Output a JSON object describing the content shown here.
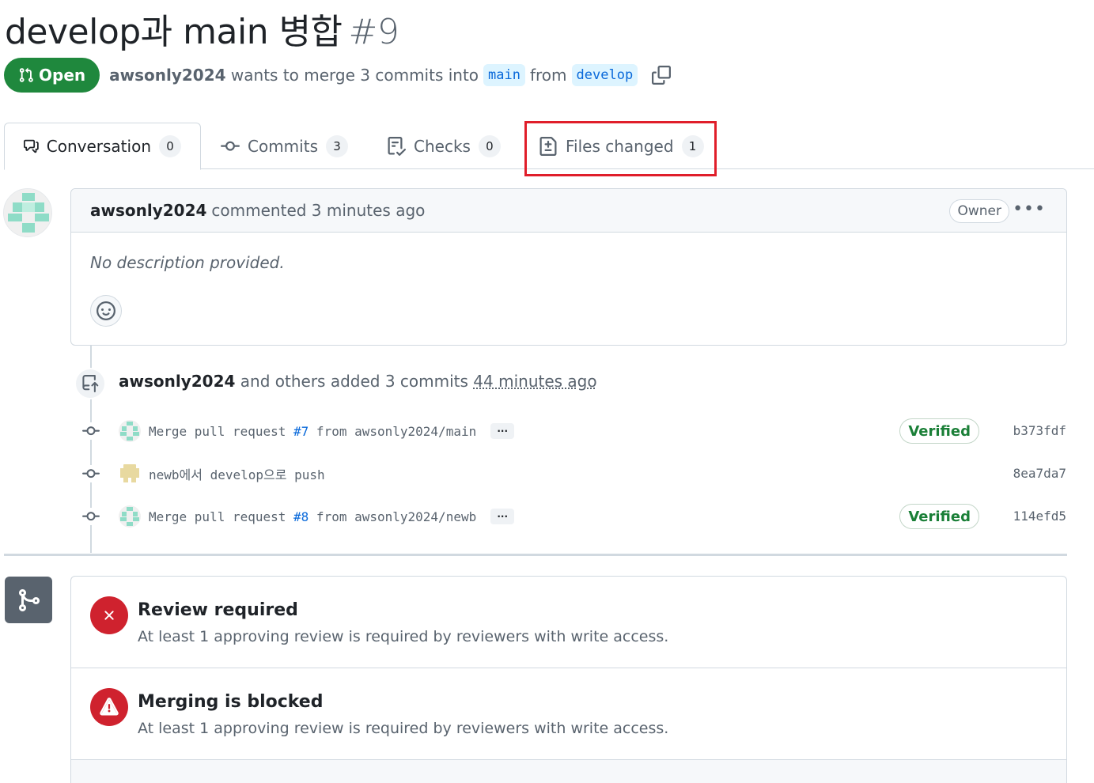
{
  "pr": {
    "title": "develop과 main 병합",
    "number": "#9",
    "state": "Open",
    "author": "awsonly2024",
    "action_text": "wants to merge 3 commits into",
    "base_branch": "main",
    "from_text": "from",
    "head_branch": "develop"
  },
  "tabs": [
    {
      "label": "Conversation",
      "count": "0",
      "icon": "comment-discussion-icon"
    },
    {
      "label": "Commits",
      "count": "3",
      "icon": "git-commit-icon"
    },
    {
      "label": "Checks",
      "count": "0",
      "icon": "checklist-icon"
    },
    {
      "label": "Files changed",
      "count": "1",
      "icon": "file-diff-icon"
    }
  ],
  "highlight_color": "#e01e2a",
  "comment": {
    "author": "awsonly2024",
    "meta": "commented 3 minutes ago",
    "badge": "Owner",
    "menu": "•••",
    "body": "No description provided."
  },
  "push_event": {
    "author": "awsonly2024",
    "text": "and others added 3 commits",
    "time": "44 minutes ago"
  },
  "commits": [
    {
      "prefix": "Merge pull request ",
      "pr_link": "#7",
      "suffix": " from awsonly2024/main",
      "has_ellipsis": true,
      "ellipsis": "···",
      "verified": "Verified",
      "sha": "b373fdf"
    },
    {
      "prefix": "newb에서 develop으로 push",
      "pr_link": "",
      "suffix": "",
      "has_ellipsis": false,
      "ellipsis": "",
      "verified": "",
      "sha": "8ea7da7"
    },
    {
      "prefix": "Merge pull request ",
      "pr_link": "#8",
      "suffix": " from awsonly2024/newb",
      "has_ellipsis": true,
      "ellipsis": "···",
      "verified": "Verified",
      "sha": "114efd5"
    }
  ],
  "merge": {
    "review": {
      "title": "Review required",
      "desc": "At least 1 approving review is required by reviewers with write access.",
      "icon": "x-icon"
    },
    "blocked": {
      "title": "Merging is blocked",
      "desc": "At least 1 approving review is required by reviewers with write access.",
      "icon": "alert-icon"
    }
  },
  "colors": {
    "open_green": "#1f883d",
    "branch_bg": "#ddf4ff",
    "branch_fg": "#0969da",
    "danger": "#cf222e",
    "verified": "#1a7f37"
  }
}
